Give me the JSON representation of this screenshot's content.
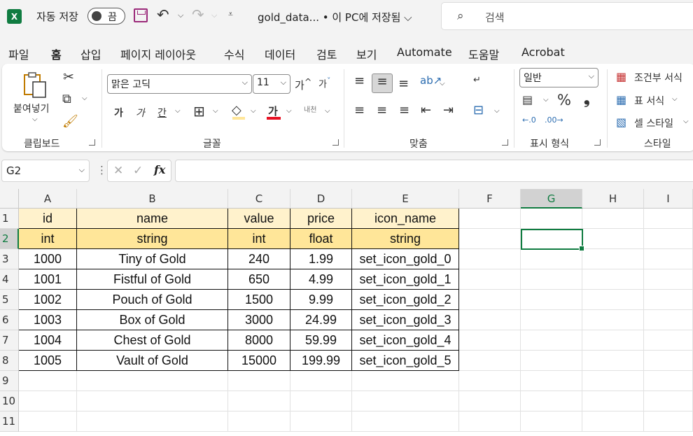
{
  "titlebar": {
    "app_logo": "X",
    "autosave_label": "자동 저장",
    "toggle_state": "끔",
    "doc_title": "gold_data... • 이 PC에 저장됨 ⌵",
    "search_placeholder": "검색"
  },
  "menu": [
    "파일",
    "홈",
    "삽입",
    "페이지 레이아웃",
    "수식",
    "데이터",
    "검토",
    "보기",
    "Automate",
    "도움말",
    "Acrobat"
  ],
  "menu_active": "홈",
  "ribbon": {
    "clipboard": {
      "paste_label": "붙여넣기",
      "group_label": "클립보드"
    },
    "font": {
      "font_name": "맑은 고딕",
      "font_size": "11",
      "bold": "가",
      "italic": "가",
      "underline": "간",
      "font_color": "가",
      "wrap_hint": "내천",
      "grow": "가",
      "shrink": "가",
      "group_label": "글꼴"
    },
    "alignment": {
      "group_label": "맞춤"
    },
    "number": {
      "format": "일반",
      "percent": "%",
      "comma": "❟",
      "group_label": "표시 형식"
    },
    "styles": {
      "conditional": "조건부 서식",
      "table": "표 서식",
      "cell_styles": "셀 스타일",
      "group_label": "스타일"
    }
  },
  "formula_bar": {
    "name_box": "G2",
    "fx": "fx",
    "formula": ""
  },
  "sheet": {
    "columns": [
      "A",
      "B",
      "C",
      "D",
      "E",
      "F",
      "G",
      "H",
      "I"
    ],
    "selected_column": "G",
    "row_numbers": [
      "1",
      "2",
      "3",
      "4",
      "5",
      "6",
      "7",
      "8",
      "9",
      "10",
      "11"
    ],
    "selected_row": "2",
    "selected_cell": "G2",
    "rows": [
      [
        "id",
        "name",
        "value",
        "price",
        "icon_name"
      ],
      [
        "int",
        "string",
        "int",
        "float",
        "string"
      ],
      [
        "1000",
        "Tiny of Gold",
        "240",
        "1.99",
        "set_icon_gold_0"
      ],
      [
        "1001",
        "Fistful of Gold",
        "650",
        "4.99",
        "set_icon_gold_1"
      ],
      [
        "1002",
        "Pouch of Gold",
        "1500",
        "9.99",
        "set_icon_gold_2"
      ],
      [
        "1003",
        "Box of Gold",
        "3000",
        "24.99",
        "set_icon_gold_3"
      ],
      [
        "1004",
        "Chest of Gold",
        "8000",
        "59.99",
        "set_icon_gold_4"
      ],
      [
        "1005",
        "Vault of Gold",
        "15000",
        "199.99",
        "set_icon_gold_5"
      ]
    ]
  },
  "colors": {
    "accent": "#107c41",
    "header_row1": "#fff2cc",
    "header_row2": "#ffe699",
    "save_icon": "#9b2a7a",
    "font_color_bar": "#e81123"
  }
}
